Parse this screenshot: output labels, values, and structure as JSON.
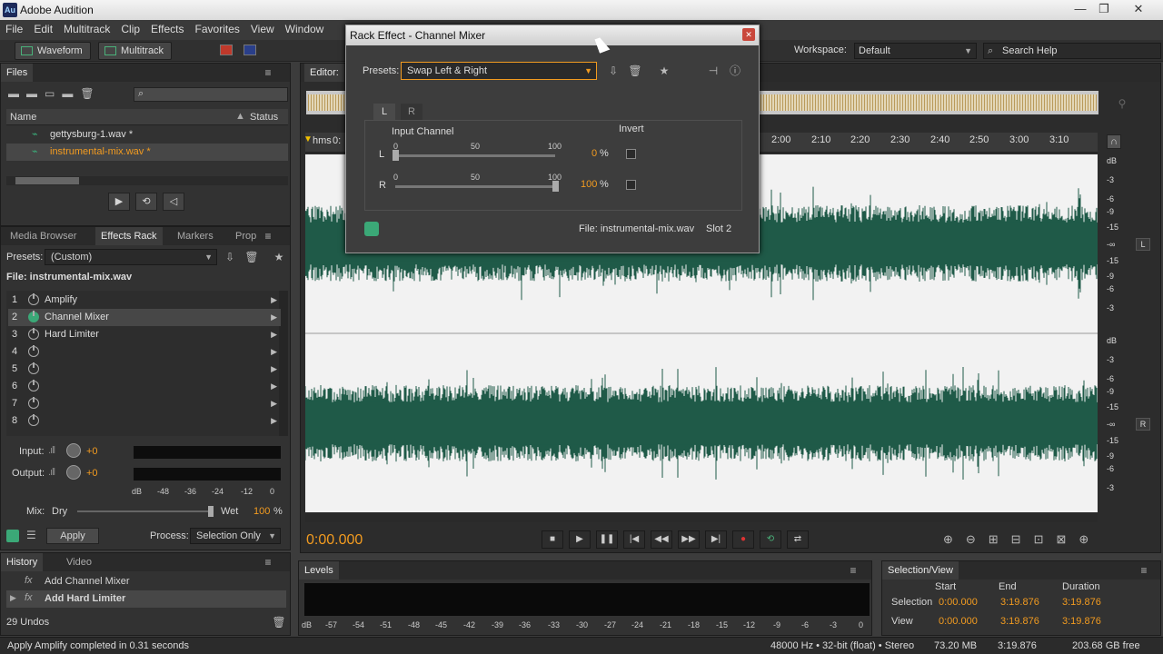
{
  "app": {
    "title": "Adobe Audition",
    "logo": "Au"
  },
  "window_controls": [
    "—",
    "❐",
    "✕"
  ],
  "menu": [
    "File",
    "Edit",
    "Multitrack",
    "Clip",
    "Effects",
    "Favorites",
    "View",
    "Window"
  ],
  "toolbar": {
    "waveform": "Waveform",
    "multitrack": "Multitrack",
    "workspace_label": "Workspace:",
    "workspace_value": "Default",
    "search_placeholder": "Search Help"
  },
  "files_panel": {
    "tab": "Files",
    "col_name": "Name",
    "col_status": "Status",
    "files": [
      "gettysburg-1.wav *",
      "instrumental-mix.wav *"
    ]
  },
  "effects_panel": {
    "tabs": [
      "Media Browser",
      "Effects Rack",
      "Markers",
      "Prop"
    ],
    "presets_label": "Presets:",
    "presets_value": "(Custom)",
    "file_label": "File: instrumental-mix.wav",
    "slots": [
      {
        "n": "1",
        "name": "Amplify"
      },
      {
        "n": "2",
        "name": "Channel Mixer"
      },
      {
        "n": "3",
        "name": "Hard Limiter"
      },
      {
        "n": "4",
        "name": ""
      },
      {
        "n": "5",
        "name": ""
      },
      {
        "n": "6",
        "name": ""
      },
      {
        "n": "7",
        "name": ""
      },
      {
        "n": "8",
        "name": ""
      }
    ],
    "input_label": "Input:",
    "input_value": "+0",
    "output_label": "Output:",
    "output_value": "+0",
    "meter_ticks": [
      "dB",
      "-48",
      "-36",
      "-24",
      "-12",
      "0"
    ],
    "mix_label": "Mix:",
    "mix_dry": "Dry",
    "mix_wet": "Wet",
    "mix_value": "100",
    "mix_unit": "%",
    "apply": "Apply",
    "process_label": "Process:",
    "process_value": "Selection Only"
  },
  "history_panel": {
    "tabs": [
      "History",
      "Video"
    ],
    "items": [
      "Add Channel Mixer",
      "Add Hard Limiter"
    ],
    "undos": "29 Undos"
  },
  "editor": {
    "tab": "Editor:",
    "ruler_unit": "hms",
    "ruler_first": "0:",
    "ruler": [
      "2:00",
      "2:10",
      "2:20",
      "2:30",
      "2:40",
      "2:50",
      "3:00",
      "3:10"
    ],
    "db_top": [
      "dB",
      "-3",
      "-6",
      "-9",
      "-15",
      "-∞",
      "-15",
      "-9",
      "-6",
      "-3"
    ],
    "db_bottom": [
      "dB",
      "-3",
      "-6",
      "-9",
      "-15",
      "-∞",
      "-15",
      "-9",
      "-6",
      "-3"
    ],
    "channel_l": "L",
    "channel_r": "R",
    "time": "0:00.000"
  },
  "dialog": {
    "title": "Rack Effect - Channel Mixer",
    "presets_label": "Presets:",
    "presets_value": "Swap Left & Right",
    "tab_l": "L",
    "tab_r": "R",
    "input_channel": "Input Channel",
    "invert": "Invert",
    "rows": [
      {
        "ch": "L",
        "value": "0",
        "unit": "%",
        "level": 0
      },
      {
        "ch": "R",
        "value": "100",
        "unit": "%",
        "level": 100
      }
    ],
    "scale": [
      "0",
      "50",
      "100"
    ],
    "file": "File: instrumental-mix.wav",
    "slot": "Slot 2"
  },
  "levels_panel": {
    "tab": "Levels",
    "ticks": [
      "dB",
      "-57",
      "-54",
      "-51",
      "-48",
      "-45",
      "-42",
      "-39",
      "-36",
      "-33",
      "-30",
      "-27",
      "-24",
      "-21",
      "-18",
      "-15",
      "-12",
      "-9",
      "-6",
      "-3",
      "0"
    ]
  },
  "selection_panel": {
    "tab": "Selection/View",
    "cols": [
      "Start",
      "End",
      "Duration"
    ],
    "rows": [
      {
        "label": "Selection",
        "start": "0:00.000",
        "end": "3:19.876",
        "duration": "3:19.876"
      },
      {
        "label": "View",
        "start": "0:00.000",
        "end": "3:19.876",
        "duration": "3:19.876"
      }
    ]
  },
  "status": {
    "message": "Apply Amplify completed in 0.31 seconds",
    "format": "48000 Hz • 32-bit (float) • Stereo",
    "size": "73.20 MB",
    "duration": "3:19.876",
    "free": "203.68 GB free"
  },
  "colors": {
    "accent": "#f29b20",
    "wave": "#1f5a48",
    "active": "#3ba877"
  }
}
